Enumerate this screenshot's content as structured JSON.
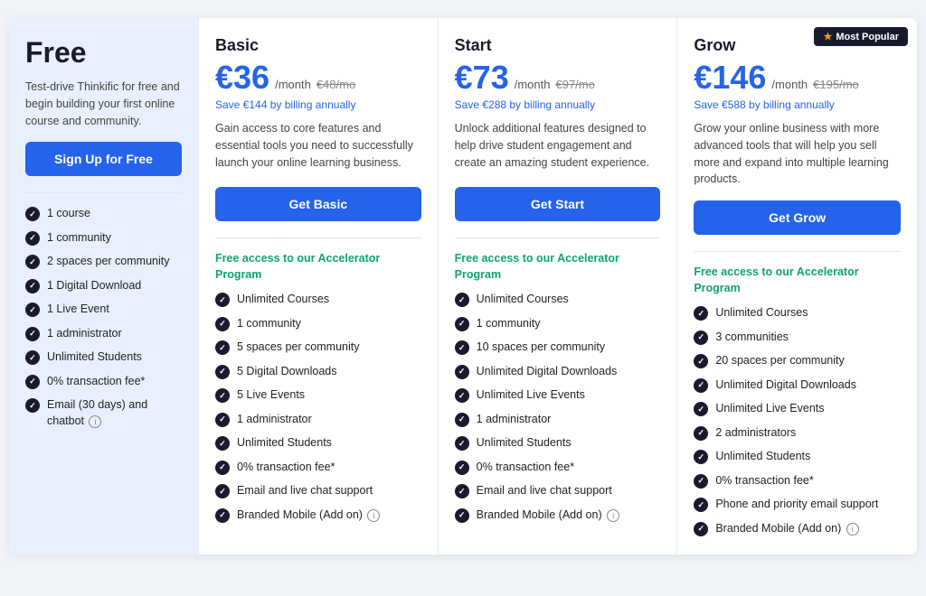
{
  "plans": {
    "free": {
      "name": "Free",
      "price_main": "",
      "price_period": "",
      "price_original": "",
      "price_save": "",
      "description": "Test-drive Thinkific for free and begin building your first online course and community.",
      "cta_label": "Sign Up for Free",
      "features": [
        {
          "text": "1 course",
          "icon": "check"
        },
        {
          "text": "1 community",
          "icon": "check"
        },
        {
          "text": "2 spaces per community",
          "icon": "check"
        },
        {
          "text": "1 Digital Download",
          "icon": "check"
        },
        {
          "text": "1 Live Event",
          "icon": "check"
        },
        {
          "text": "1 administrator",
          "icon": "check"
        },
        {
          "text": "Unlimited Students",
          "icon": "check"
        },
        {
          "text": "0% transaction fee*",
          "icon": "check"
        },
        {
          "text": "Email (30 days) and chatbot",
          "icon": "check",
          "info": true
        }
      ]
    },
    "basic": {
      "name": "Basic",
      "price_main": "€36",
      "price_period": "/month",
      "price_original": "€48/mo",
      "price_save": "Save €144 by billing annually",
      "description": "Gain access to core features and essential tools you need to successfully launch your online learning business.",
      "cta_label": "Get Basic",
      "accelerator": "Free access to our Accelerator Program",
      "features": [
        {
          "text": "Unlimited Courses"
        },
        {
          "text": "1 community"
        },
        {
          "text": "5 spaces per community"
        },
        {
          "text": "5 Digital Downloads"
        },
        {
          "text": "5 Live Events"
        },
        {
          "text": "1 administrator"
        },
        {
          "text": "Unlimited Students"
        },
        {
          "text": "0% transaction fee*"
        },
        {
          "text": "Email and live chat support"
        },
        {
          "text": "Branded Mobile (Add on)",
          "info": true
        }
      ]
    },
    "start": {
      "name": "Start",
      "price_main": "€73",
      "price_period": "/month",
      "price_original": "€97/mo",
      "price_save": "Save €288 by billing annually",
      "description": "Unlock additional features designed to help drive student engagement and create an amazing student experience.",
      "cta_label": "Get Start",
      "accelerator": "Free access to our Accelerator Program",
      "features": [
        {
          "text": "Unlimited Courses"
        },
        {
          "text": "1 community"
        },
        {
          "text": "10 spaces per community"
        },
        {
          "text": "Unlimited Digital Downloads"
        },
        {
          "text": "Unlimited Live Events"
        },
        {
          "text": "1 administrator"
        },
        {
          "text": "Unlimited Students"
        },
        {
          "text": "0% transaction fee*"
        },
        {
          "text": "Email and live chat support"
        },
        {
          "text": "Branded Mobile (Add on)",
          "info": true
        }
      ]
    },
    "grow": {
      "name": "Grow",
      "price_main": "€146",
      "price_period": "/month",
      "price_original": "€195/mo",
      "price_save": "Save €588 by billing annually",
      "description": "Grow your online business with more advanced tools that will help you sell more and expand into multiple learning products.",
      "cta_label": "Get Grow",
      "accelerator": "Free access to our Accelerator Program",
      "most_popular": "★ Most Popular",
      "features": [
        {
          "text": "Unlimited Courses"
        },
        {
          "text": "3 communities"
        },
        {
          "text": "20 spaces per community"
        },
        {
          "text": "Unlimited Digital Downloads"
        },
        {
          "text": "Unlimited Live Events"
        },
        {
          "text": "2 administrators"
        },
        {
          "text": "Unlimited Students"
        },
        {
          "text": "0% transaction fee*"
        },
        {
          "text": "Phone and priority email support"
        },
        {
          "text": "Branded Mobile (Add on)",
          "info": true
        }
      ]
    }
  },
  "icons": {
    "star": "★",
    "info": "i",
    "check": "✓"
  }
}
